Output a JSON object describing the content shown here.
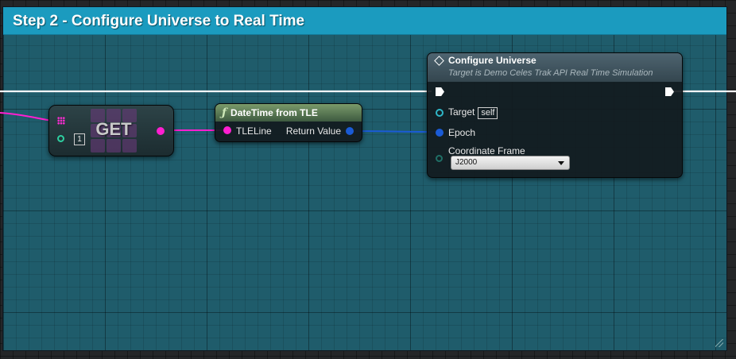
{
  "comment": {
    "title": "Step 2 - Configure Universe to Real Time",
    "color": "#1b9bbf"
  },
  "get_node": {
    "label": "GET",
    "index_value": "1"
  },
  "datetime_node": {
    "icon": "function-icon",
    "title": "DateTime from TLE",
    "input_pin": "TLELine",
    "output_pin": "Return Value"
  },
  "configure_node": {
    "title": "Configure Universe",
    "subtitle": "Target is Demo Celes Trak API Real Time Simulation",
    "target_label": "Target",
    "target_value": "self",
    "epoch_label": "Epoch",
    "frame_label": "Coordinate Frame",
    "frame_value": "J2000"
  },
  "colors": {
    "string_pin": "#ff1fd0",
    "struct_pin": "#1a5bd6",
    "object_pin": "#2fb7c8",
    "int_pin": "#2ecfa0",
    "exec_wire": "#ffffff"
  }
}
